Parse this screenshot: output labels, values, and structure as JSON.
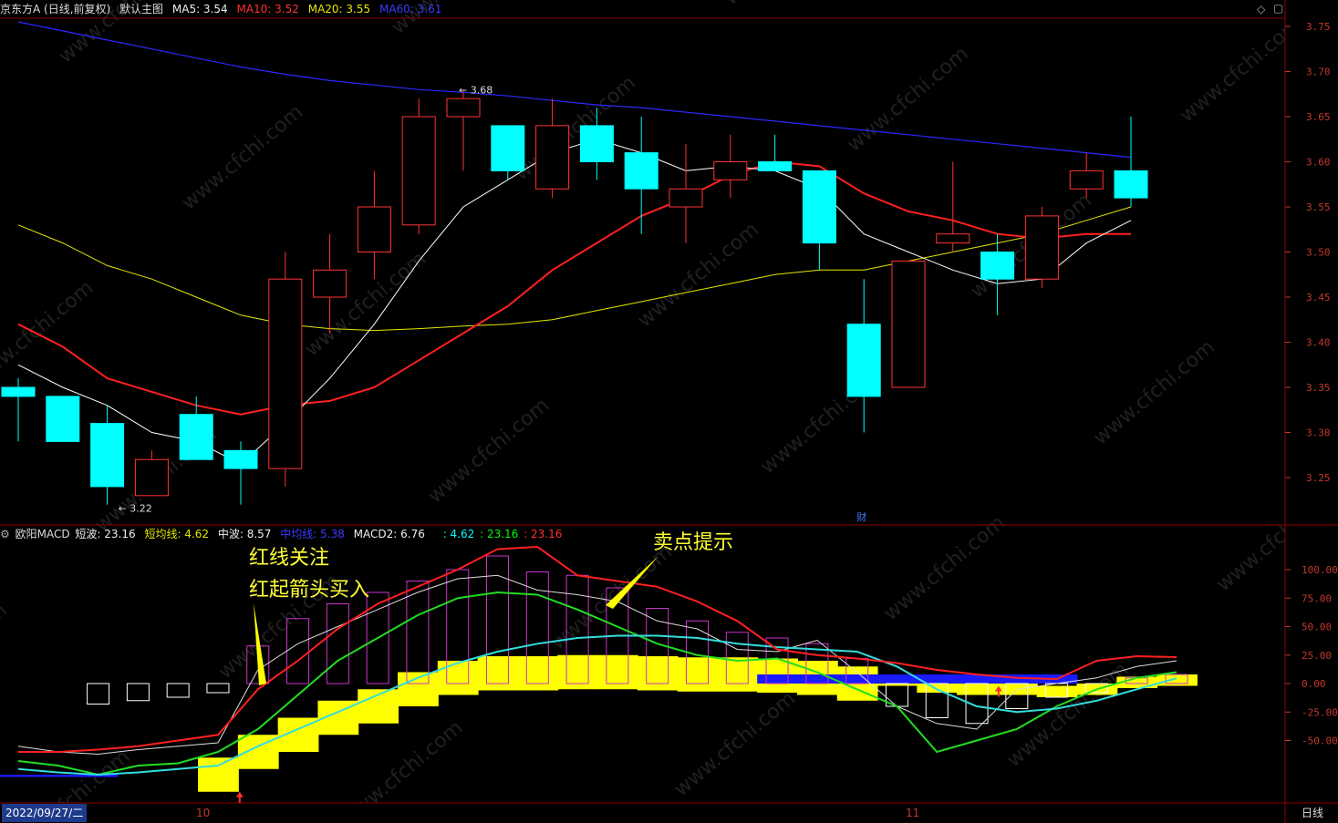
{
  "header": {
    "stock": "京东方A (日线,前复权)",
    "panel_name": "默认主图",
    "ma5": "MA5: 3.54",
    "ma10": "MA10: 3.52",
    "ma20": "MA20: 3.55",
    "ma60": "MA60: 3.61"
  },
  "macd_header": {
    "name": "欧阳MACD",
    "short": "短波: 23.16",
    "short_avg": "短均线: 4.62",
    "mid": "中波: 8.57",
    "mid_line": "中均线: 5.38",
    "macd2": "MACD2: 6.76",
    "v1": ": 4.62",
    "v2": ": 23.16",
    "v3": ": 23.16"
  },
  "colors": {
    "up": "#ff3333",
    "down": "#00ffff",
    "ma5": "#ffffff",
    "ma10": "#ff2020",
    "ma20": "#e6e600",
    "ma60": "#2a2aff",
    "grid": "#8b0000"
  },
  "annotations": {
    "red_line_watch": "红线关注",
    "red_arrow_buy": "红起箭头买入",
    "sell_hint": "卖点提示"
  },
  "x_axis": {
    "date_box": "2022/09/27/二",
    "tick_oct": "10",
    "tick_nov": "11",
    "period": "日线"
  },
  "watermark": "www.cfchi.com",
  "price_marks": {
    "high": "3.68",
    "low": "3.22",
    "fin_icon": "财"
  },
  "chart_data": [
    {
      "type": "candlestick",
      "title": "京东方A (日线,前复权)",
      "ylim": [
        3.2,
        3.78
      ],
      "yticks": [
        "3.75",
        "3.70",
        "3.65",
        "3.60",
        "3.55",
        "3.50",
        "3.45",
        "3.40",
        "3.35",
        "3.30",
        "3.25"
      ],
      "candles": [
        {
          "o": 3.35,
          "h": 3.36,
          "l": 3.29,
          "c": 3.34
        },
        {
          "o": 3.34,
          "h": 3.34,
          "l": 3.29,
          "c": 3.29
        },
        {
          "o": 3.31,
          "h": 3.33,
          "l": 3.22,
          "c": 3.24
        },
        {
          "o": 3.23,
          "h": 3.28,
          "l": 3.23,
          "c": 3.27
        },
        {
          "o": 3.32,
          "h": 3.34,
          "l": 3.27,
          "c": 3.27
        },
        {
          "o": 3.28,
          "h": 3.29,
          "l": 3.22,
          "c": 3.26
        },
        {
          "o": 3.26,
          "h": 3.5,
          "l": 3.24,
          "c": 3.47
        },
        {
          "o": 3.45,
          "h": 3.52,
          "l": 3.41,
          "c": 3.48
        },
        {
          "o": 3.5,
          "h": 3.59,
          "l": 3.47,
          "c": 3.55
        },
        {
          "o": 3.53,
          "h": 3.67,
          "l": 3.52,
          "c": 3.65
        },
        {
          "o": 3.65,
          "h": 3.68,
          "l": 3.59,
          "c": 3.67
        },
        {
          "o": 3.64,
          "h": 3.64,
          "l": 3.58,
          "c": 3.59
        },
        {
          "o": 3.57,
          "h": 3.67,
          "l": 3.56,
          "c": 3.64
        },
        {
          "o": 3.64,
          "h": 3.66,
          "l": 3.58,
          "c": 3.6
        },
        {
          "o": 3.61,
          "h": 3.65,
          "l": 3.52,
          "c": 3.57
        },
        {
          "o": 3.55,
          "h": 3.62,
          "l": 3.51,
          "c": 3.57
        },
        {
          "o": 3.58,
          "h": 3.63,
          "l": 3.56,
          "c": 3.6
        },
        {
          "o": 3.6,
          "h": 3.63,
          "l": 3.59,
          "c": 3.59
        },
        {
          "o": 3.59,
          "h": 3.59,
          "l": 3.48,
          "c": 3.51
        },
        {
          "o": 3.42,
          "h": 3.47,
          "l": 3.3,
          "c": 3.34
        },
        {
          "o": 3.35,
          "h": 3.49,
          "l": 3.35,
          "c": 3.49
        },
        {
          "o": 3.51,
          "h": 3.6,
          "l": 3.5,
          "c": 3.52
        },
        {
          "o": 3.5,
          "h": 3.52,
          "l": 3.43,
          "c": 3.47
        },
        {
          "o": 3.47,
          "h": 3.55,
          "l": 3.46,
          "c": 3.54
        },
        {
          "o": 3.57,
          "h": 3.61,
          "l": 3.56,
          "c": 3.59
        },
        {
          "o": 3.59,
          "h": 3.65,
          "l": 3.55,
          "c": 3.56
        }
      ],
      "ma5": [
        3.375,
        3.35,
        3.33,
        3.3,
        3.29,
        3.265,
        3.31,
        3.36,
        3.42,
        3.49,
        3.55,
        3.58,
        3.61,
        3.625,
        3.61,
        3.59,
        3.595,
        3.59,
        3.57,
        3.52,
        3.5,
        3.48,
        3.465,
        3.47,
        3.51,
        3.535
      ],
      "ma10": [
        3.42,
        3.395,
        3.36,
        3.345,
        3.33,
        3.32,
        3.33,
        3.335,
        3.35,
        3.38,
        3.41,
        3.44,
        3.48,
        3.51,
        3.54,
        3.56,
        3.585,
        3.6,
        3.595,
        3.565,
        3.545,
        3.535,
        3.52,
        3.515,
        3.52,
        3.52
      ],
      "ma20": [
        3.53,
        3.51,
        3.485,
        3.47,
        3.45,
        3.43,
        3.42,
        3.415,
        3.413,
        3.415,
        3.418,
        3.42,
        3.425,
        3.435,
        3.445,
        3.455,
        3.465,
        3.475,
        3.48,
        3.48,
        3.49,
        3.5,
        3.51,
        3.52,
        3.535,
        3.55
      ],
      "ma60": [
        3.755,
        3.745,
        3.735,
        3.725,
        3.715,
        3.705,
        3.697,
        3.69,
        3.685,
        3.68,
        3.677,
        3.673,
        3.668,
        3.663,
        3.66,
        3.655,
        3.65,
        3.645,
        3.64,
        3.635,
        3.63,
        3.625,
        3.62,
        3.615,
        3.61,
        3.605
      ]
    },
    {
      "type": "bar",
      "title": "欧阳MACD",
      "ylim": [
        -100,
        125
      ],
      "yticks": [
        "100.00",
        "75.00",
        "50.00",
        "25.00",
        "0.00",
        "-25.00",
        "-50.00"
      ],
      "short_wave": [
        -55,
        -60,
        -62,
        -58,
        -55,
        -52,
        12,
        35,
        50,
        65,
        80,
        92,
        95,
        82,
        78,
        72,
        55,
        48,
        30,
        28,
        38,
        10,
        -20,
        -35,
        -40,
        -5,
        0,
        5,
        15,
        20
      ],
      "short_avg": [
        -75,
        -78,
        -80,
        -78,
        -75,
        -72,
        -55,
        -40,
        -25,
        -10,
        5,
        18,
        28,
        35,
        40,
        42,
        42,
        40,
        35,
        32,
        30,
        28,
        15,
        -5,
        -20,
        -25,
        -22,
        -15,
        -5,
        4.62
      ],
      "mid_wave": [
        -68,
        -72,
        -80,
        -72,
        -70,
        -60,
        -40,
        -10,
        20,
        40,
        60,
        75,
        80,
        78,
        65,
        50,
        35,
        25,
        20,
        22,
        10,
        -5,
        -20,
        -60,
        -50,
        -40,
        -20,
        -5,
        5,
        10
      ],
      "macd_hist": [
        0,
        0,
        -18,
        -15,
        -12,
        -8,
        33,
        57,
        70,
        80,
        90,
        100,
        112,
        98,
        95,
        84,
        66,
        55,
        45,
        40,
        35,
        22,
        -20,
        -30,
        -35,
        -22,
        -12,
        -8,
        5,
        8
      ],
      "yellow_band": [
        -82,
        -82,
        -82,
        -80,
        -78,
        -65,
        -45,
        -30,
        -15,
        -5,
        10,
        20,
        24,
        24,
        25,
        25,
        24,
        23,
        23,
        22,
        20,
        15,
        8,
        2,
        0,
        0,
        -2,
        0,
        6,
        8
      ],
      "red_line": [
        -60,
        -60,
        -58,
        -55,
        -50,
        -45,
        -5,
        20,
        48,
        70,
        85,
        100,
        118,
        120,
        95,
        90,
        85,
        72,
        55,
        30,
        25,
        22,
        18,
        12,
        8,
        5,
        4,
        20,
        24,
        23.16
      ]
    }
  ]
}
